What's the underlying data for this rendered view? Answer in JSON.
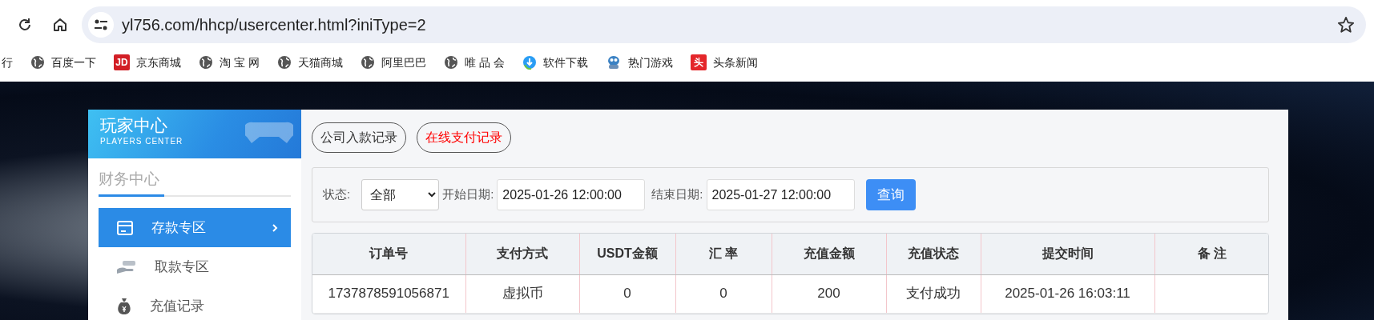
{
  "browser": {
    "url": "yl756.com/hhcp/usercenter.html?iniType=2",
    "bookmarks": [
      {
        "label": "行",
        "kind": "plain"
      },
      {
        "label": "百度一下",
        "kind": "globe"
      },
      {
        "label": "京东商城",
        "kind": "logo",
        "logo_text": "JD",
        "color": "#d21f26"
      },
      {
        "label": "淘 宝 网",
        "kind": "globe"
      },
      {
        "label": "天猫商城",
        "kind": "globe"
      },
      {
        "label": "阿里巴巴",
        "kind": "globe"
      },
      {
        "label": "唯 品 会",
        "kind": "globe"
      },
      {
        "label": "软件下载",
        "kind": "download"
      },
      {
        "label": "热门游戏",
        "kind": "game"
      },
      {
        "label": "头条新闻",
        "kind": "logo",
        "logo_text": "头",
        "color": "#e4262a"
      }
    ]
  },
  "sidebar": {
    "title": "玩家中心",
    "subtitle": "PLAYERS CENTER",
    "section": "财务中心",
    "items": [
      {
        "label": "存款专区",
        "kind": "deposit",
        "selected": true
      },
      {
        "label": "取款专区",
        "kind": "withdraw",
        "selected": false
      },
      {
        "label": "充值记录",
        "kind": "records",
        "selected": false
      }
    ]
  },
  "tabs": [
    {
      "label": "公司入款记录",
      "selected": false
    },
    {
      "label": "在线支付记录",
      "selected": true
    }
  ],
  "filter": {
    "status_label": "状态:",
    "status_value": "全部",
    "start_label": "开始日期:",
    "start_value": "2025-01-26 12:00:00",
    "end_label": "结束日期:",
    "end_value": "2025-01-27 12:00:00",
    "button": "查询"
  },
  "table": {
    "columns": [
      "订单号",
      "支付方式",
      "USDT金额",
      "汇 率",
      "充值金额",
      "充值状态",
      "提交时间",
      "备 注"
    ],
    "rows": [
      [
        "1737878591056871",
        "虚拟币",
        "0",
        "0",
        "200",
        "支付成功",
        "2025-01-26 16:03:11",
        null
      ]
    ]
  }
}
